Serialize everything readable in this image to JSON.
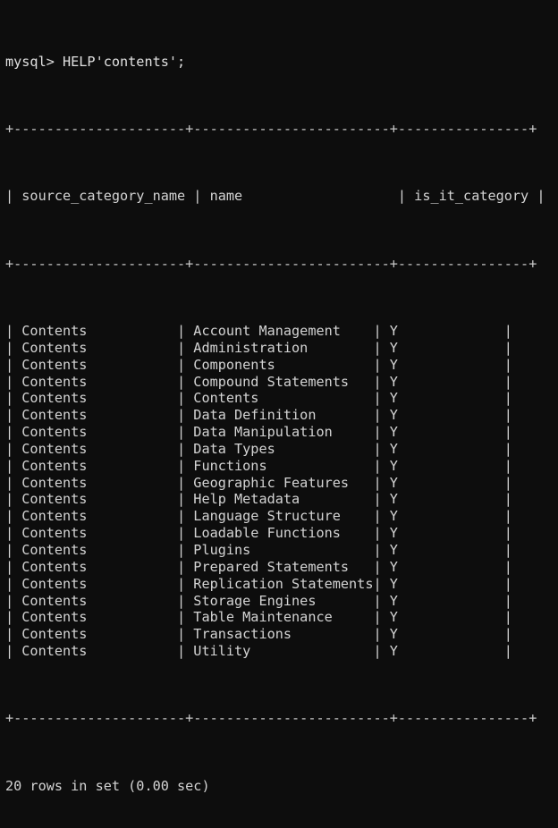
{
  "terminal": {
    "shell_prompt": "mysql> ",
    "command": "HELP'contents';",
    "prompt_line": "mysql> HELP'contents';",
    "background_color": "#0d0d0d",
    "text_color": "#d4d4d4",
    "border_color": "#c8c8c8"
  },
  "table": {
    "border_rule": "+---------------------+------------------------+----------------+",
    "columns": [
      {
        "key": "source_category_name",
        "header": "source_category_name",
        "width": 20
      },
      {
        "key": "name",
        "header": "name",
        "width": 23
      },
      {
        "key": "is_it_category",
        "header": "is_it_category",
        "width": 15
      }
    ],
    "header_row": "| source_category_name | name                   | is_it_category |",
    "rows": [
      {
        "source_category_name": "Contents",
        "name": "Account Management",
        "is_it_category": "Y"
      },
      {
        "source_category_name": "Contents",
        "name": "Administration",
        "is_it_category": "Y"
      },
      {
        "source_category_name": "Contents",
        "name": "Components",
        "is_it_category": "Y"
      },
      {
        "source_category_name": "Contents",
        "name": "Compound Statements",
        "is_it_category": "Y"
      },
      {
        "source_category_name": "Contents",
        "name": "Contents",
        "is_it_category": "Y"
      },
      {
        "source_category_name": "Contents",
        "name": "Data Definition",
        "is_it_category": "Y"
      },
      {
        "source_category_name": "Contents",
        "name": "Data Manipulation",
        "is_it_category": "Y"
      },
      {
        "source_category_name": "Contents",
        "name": "Data Types",
        "is_it_category": "Y"
      },
      {
        "source_category_name": "Contents",
        "name": "Functions",
        "is_it_category": "Y"
      },
      {
        "source_category_name": "Contents",
        "name": "Geographic Features",
        "is_it_category": "Y"
      },
      {
        "source_category_name": "Contents",
        "name": "Help Metadata",
        "is_it_category": "Y"
      },
      {
        "source_category_name": "Contents",
        "name": "Language Structure",
        "is_it_category": "Y"
      },
      {
        "source_category_name": "Contents",
        "name": "Loadable Functions",
        "is_it_category": "Y"
      },
      {
        "source_category_name": "Contents",
        "name": "Plugins",
        "is_it_category": "Y"
      },
      {
        "source_category_name": "Contents",
        "name": "Prepared Statements",
        "is_it_category": "Y"
      },
      {
        "source_category_name": "Contents",
        "name": "Replication Statements",
        "is_it_category": "Y"
      },
      {
        "source_category_name": "Contents",
        "name": "Storage Engines",
        "is_it_category": "Y"
      },
      {
        "source_category_name": "Contents",
        "name": "Table Maintenance",
        "is_it_category": "Y"
      },
      {
        "source_category_name": "Contents",
        "name": "Transactions",
        "is_it_category": "Y"
      },
      {
        "source_category_name": "Contents",
        "name": "Utility",
        "is_it_category": "Y"
      }
    ]
  },
  "result_summary": {
    "row_count": 20,
    "duration_seconds": "0.00",
    "text": "20 rows in set (0.00 sec)"
  }
}
